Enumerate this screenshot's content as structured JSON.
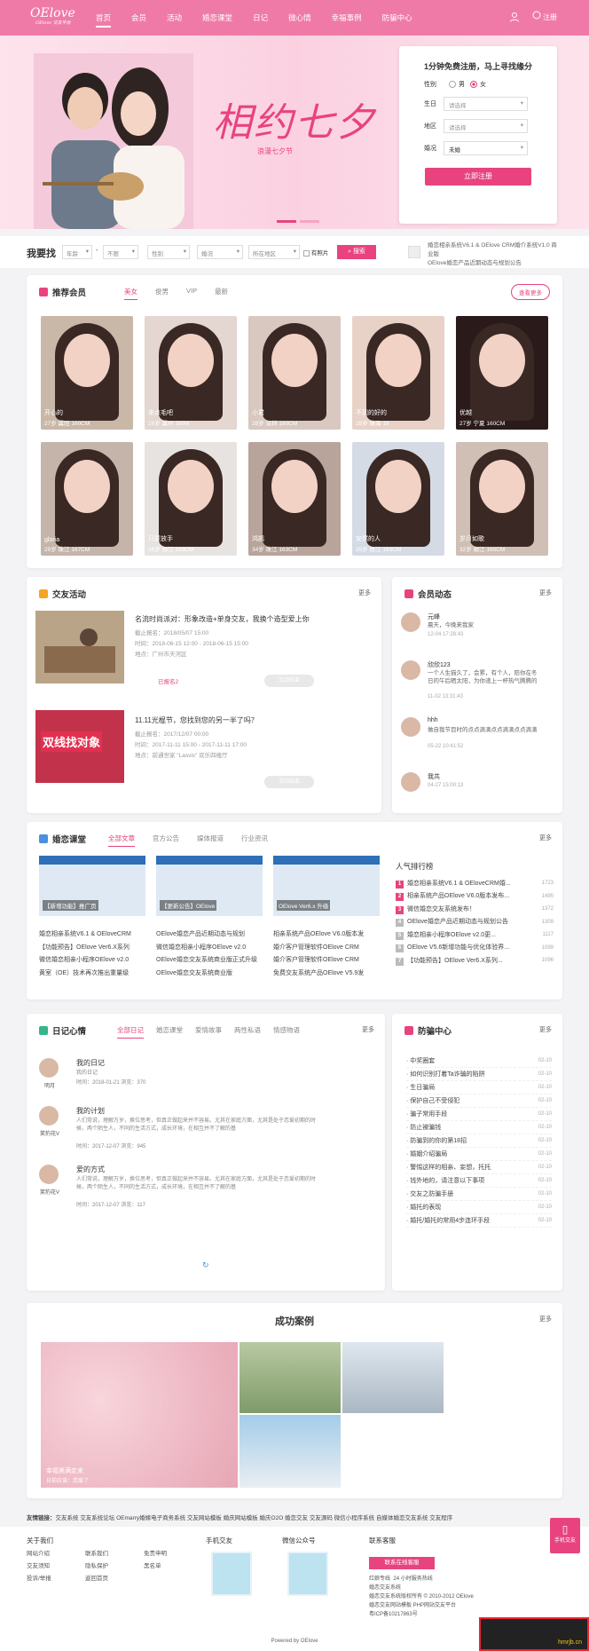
{
  "header": {
    "logo": "OElove",
    "logo_sub": "OElove 交友平台",
    "nav": [
      "首页",
      "会员",
      "活动",
      "婚恋课堂",
      "日记",
      "微心情",
      "幸福事例",
      "防骗中心"
    ],
    "register": "注册"
  },
  "hero": {
    "title": "相约七夕",
    "subtitle": "浪漫七夕节"
  },
  "reg_form": {
    "title": "1分钟免费注册，马上寻找缘分",
    "gender_label": "性别",
    "male": "男",
    "female": "女",
    "birth_label": "生日",
    "birth_ph": "请选择",
    "area_label": "地区",
    "area_ph": "请选择",
    "marriage_label": "婚况",
    "marriage_val": "未婚",
    "submit": "立即注册"
  },
  "search": {
    "label": "我要找",
    "age_from": "年龄",
    "dash": "-",
    "age_to": "不限",
    "gender": "性别",
    "marriage": "婚况",
    "area": "所在地区",
    "has_photo": "有照片",
    "btn": "搜索",
    "ann1": "婚恋相亲系统V6.1 & OElove CRM婚介系统V1.0 商业版",
    "ann2": "OElove婚恋产品近期动态与规划公告"
  },
  "members": {
    "title": "推荐会员",
    "tabs": [
      "美女",
      "俊男",
      "VIP",
      "最新"
    ],
    "more": "查看更多",
    "list": [
      {
        "name": "开心的",
        "info": "27岁 翼阳 160CM"
      },
      {
        "name": "来点毛吧",
        "info": "28岁 翼州 160M"
      },
      {
        "name": "小君",
        "info": "28岁 深圳 160CM"
      },
      {
        "name": "不到的好的",
        "info": "28岁 珠海 16"
      },
      {
        "name": "优越",
        "info": "27岁 宁夏 160CM"
      },
      {
        "name": "gloria",
        "info": "29岁 珠江 167CM"
      },
      {
        "name": "只要放手",
        "info": "36岁 扬江 163CM"
      },
      {
        "name": "鸿鹄",
        "info": "34岁 珠江 163CM"
      },
      {
        "name": "安然的人",
        "info": "25岁 扬江 163CM"
      },
      {
        "name": "岁月如歌",
        "info": "32岁 顺江 165CM"
      }
    ]
  },
  "activities": {
    "title": "交友活动",
    "more": "更多",
    "list": [
      {
        "title": "名流时尚派对：形象改造+单身交友，我换个造型爱上你",
        "deadline": "截止报名：2018/05/07 15:00",
        "time": "时间：2018-06-15 12:00 - 2018-06-15 15:00",
        "place": "地点：广州市天河区",
        "joined": "已报名2",
        "btn": "活动结束"
      },
      {
        "title": "11.11光棍节，您找到您的另一半了吗？",
        "deadline": "截止报名：2017/12/07 00:00",
        "time": "时间：2017-11-11 15:00 - 2017-11-11 17:00",
        "place": "地点：前通世家 \"Lasvis\" 欢乐四楼厅",
        "joined": "",
        "btn": "活动结束"
      }
    ],
    "banner": "双线找对象"
  },
  "dynamics": {
    "title": "会员动态",
    "more": "更多",
    "list": [
      {
        "name": "元峰",
        "text": "晨天，今晚来我家",
        "date": "12-04 17:28:43"
      },
      {
        "name": "欣欣123",
        "text": "一个人生猫久了，会累，有个人，陪你在冬日的午后晒太阳，为你递上一杯热气腾腾的",
        "date": "11-02 13:31:43"
      },
      {
        "name": "hhh",
        "text": "做自我节目时的点点滴滴点点滴滴点点滴滴",
        "date": "05-22 10:41:52"
      },
      {
        "name": "我共",
        "text": "",
        "date": "04-27 15:00:13"
      }
    ]
  },
  "school": {
    "title": "婚恋课堂",
    "tabs": [
      "全部文章",
      "官方公告",
      "媒体报道",
      "行业资讯"
    ],
    "more": "更多",
    "thumbs": [
      "【新增功能】推广页",
      "【更新公告】OElove",
      "OElove Ver6.x 升级"
    ],
    "col1": [
      "婚恋相亲系统V6.1 & OEloveCRM",
      "【功能预告】OElove Ver6.X系列",
      "微信婚恋相亲小程序OElove v2.0",
      "黄室（OE）技术再次推出重量级"
    ],
    "col2": [
      "OElove婚恋产品近期动态与规划",
      "微信婚恋相亲小程序OElove v2.0",
      "OElove婚恋交友系统商业版正式升级",
      "OElove婚恋交友系统商业版"
    ],
    "col3": [
      "相亲系统产品OElove V6.0版本发",
      "婚介客户管理软件OElove CRM",
      "婚介客户管理软件OElove CRM",
      "免费交友系统产品OElove V5.9发"
    ]
  },
  "rank": {
    "title": "人气排行榜",
    "list": [
      {
        "t": "婚恋相亲系统V6.1 & OEloveCRM婚...",
        "n": "1723"
      },
      {
        "t": "相亲系统产品OElove V6.0版本发布...",
        "n": "1495"
      },
      {
        "t": "微信婚恋交友系统发布！",
        "n": "1372"
      },
      {
        "t": "OElove婚恋产品近期动态与规划公告",
        "n": "1309"
      },
      {
        "t": "婚恋相亲小程序OElove v2.0更...",
        "n": "1117"
      },
      {
        "t": "OElove V5.6新增功能与优化体验界...",
        "n": "1099"
      },
      {
        "t": "【功能预告】OElove Ver6.X系列...",
        "n": "1096"
      }
    ]
  },
  "diary": {
    "title": "日记心情",
    "tabs": [
      "全部日记",
      "婚恋课堂",
      "爱情故事",
      "两性私语",
      "情感物语"
    ],
    "more": "更多",
    "list": [
      {
        "author": "明月",
        "title": "我的日记",
        "text": "我的日记",
        "meta": "时间：2018-01-21 浏览：370"
      },
      {
        "author": "笑豹花V",
        "title": "我的计划",
        "text": "人们常说，理解万岁，换位思考，但真正做起来并不容易。尤其在家庭方面，尤其是处于恋爱初期的时候，两个陌生人，不同的生活方式，成长环境，在相互并不了解的基",
        "meta": "时间：2017-12-07 浏览：945"
      },
      {
        "author": "笑豹花V",
        "title": "爱的方式",
        "text": "人们常说，理解万岁，换位思考，但真正做起来并不容易。尤其在家庭方面，尤其是处于恋爱初期的时候，两个陌生人，不同的生活方式，成长环境，在相互并不了解的基",
        "meta": "时间：2017-12-07 浏览：117"
      }
    ]
  },
  "fraud": {
    "title": "防骗中心",
    "more": "更多",
    "list": [
      "中奖圈套",
      "如何识别打着Ta诈骗的陷阱",
      "生日骗局",
      "保护自己不受侵犯",
      "骗子常用手段",
      "防止被骗钱",
      "防骗到的你的第18招",
      "婚姻介绍骗局",
      "警惕这样的相亲、妄想，托托",
      "钱外地的，请注意以下事项",
      "交友之防骗手册",
      "婚托的表现",
      "婚托/婚托的常用4步连环手段"
    ],
    "date": "02-10"
  },
  "success": {
    "title": "成功案例",
    "more": "更多",
    "cap1": "幸福美满走来",
    "cap2": "日前应该：恋爱了"
  },
  "footer": {
    "links_label": "友情链接：",
    "links": "交友系统 交友系统论坛 OEmarry婚嫁电子商务系统 交友网站模板 婚庆网站模板 婚庆O2O 婚恋交友 交友源码 微信小程序系统 自媒体婚恋交友系统 交友程序",
    "about": "关于我们",
    "about_links": [
      "网站介绍",
      "联系我们",
      "免责申明",
      "交友须知",
      "隐私保护",
      "黑名单",
      "投诉/举报",
      "返回首页"
    ],
    "mobile": "手机交友",
    "wechat": "微信公众号",
    "service": "联系客服",
    "service_btn": "联系在线客服",
    "hotline": "红娘专线",
    "hotline_time": "24 小时服务热线",
    "copy1": "婚恋交友系统",
    "copy2": "婚恋交友系统版权所有 © 2010-2012 OElove",
    "copy3": "婚恋交友网站模板 PHP网站交友平台",
    "icp": "粤ICP备10217863号",
    "powered": "Powered by OElove",
    "side": "手机交友",
    "badge": "hmrjb.cn"
  },
  "colors": {
    "brand": "#e8437f"
  }
}
